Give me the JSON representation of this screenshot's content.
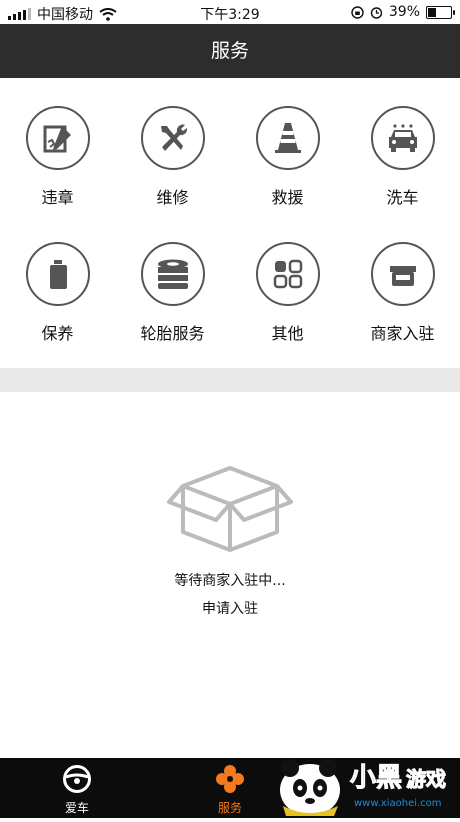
{
  "status": {
    "carrier": "中国移动",
    "time": "下午3:29",
    "battery": "39%",
    "battery_level": 0.39
  },
  "nav": {
    "title": "服务"
  },
  "services": [
    {
      "label": "违章",
      "icon": "violation-icon"
    },
    {
      "label": "维修",
      "icon": "repair-tools-icon"
    },
    {
      "label": "救援",
      "icon": "traffic-cone-icon"
    },
    {
      "label": "洗车",
      "icon": "car-wash-icon"
    },
    {
      "label": "保养",
      "icon": "oil-can-icon"
    },
    {
      "label": "轮胎服务",
      "icon": "tire-stack-icon"
    },
    {
      "label": "其他",
      "icon": "grid-icon"
    },
    {
      "label": "商家入驻",
      "icon": "storefront-icon"
    }
  ],
  "empty_state": {
    "message": "等待商家入驻中...",
    "apply": "申请入驻"
  },
  "tabs": [
    {
      "label": "爱车",
      "color": "#ffffff"
    },
    {
      "label": "服务",
      "color": "#f47a1f"
    }
  ],
  "watermark": {
    "text": "小黑游戏",
    "url": "www.xiaohei.com"
  }
}
